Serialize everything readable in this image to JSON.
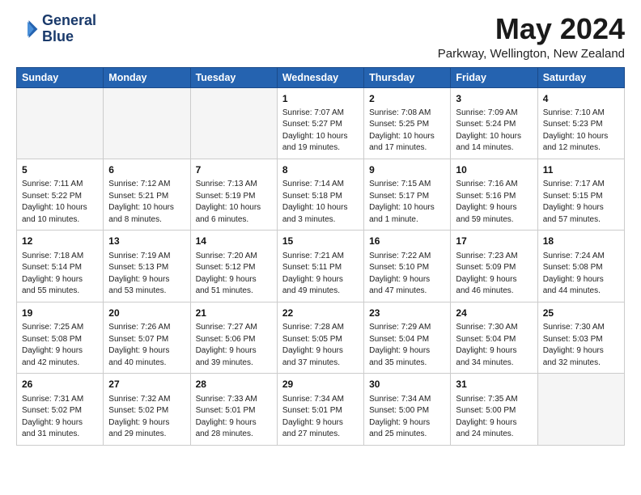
{
  "logo": {
    "line1": "General",
    "line2": "Blue"
  },
  "title": "May 2024",
  "location": "Parkway, Wellington, New Zealand",
  "days_of_week": [
    "Sunday",
    "Monday",
    "Tuesday",
    "Wednesday",
    "Thursday",
    "Friday",
    "Saturday"
  ],
  "weeks": [
    [
      {
        "day": "",
        "empty": true
      },
      {
        "day": "",
        "empty": true
      },
      {
        "day": "",
        "empty": true
      },
      {
        "day": "1",
        "sunrise": "7:07 AM",
        "sunset": "5:27 PM",
        "daylight": "10 hours and 19 minutes."
      },
      {
        "day": "2",
        "sunrise": "7:08 AM",
        "sunset": "5:25 PM",
        "daylight": "10 hours and 17 minutes."
      },
      {
        "day": "3",
        "sunrise": "7:09 AM",
        "sunset": "5:24 PM",
        "daylight": "10 hours and 14 minutes."
      },
      {
        "day": "4",
        "sunrise": "7:10 AM",
        "sunset": "5:23 PM",
        "daylight": "10 hours and 12 minutes."
      }
    ],
    [
      {
        "day": "5",
        "sunrise": "7:11 AM",
        "sunset": "5:22 PM",
        "daylight": "10 hours and 10 minutes."
      },
      {
        "day": "6",
        "sunrise": "7:12 AM",
        "sunset": "5:21 PM",
        "daylight": "10 hours and 8 minutes."
      },
      {
        "day": "7",
        "sunrise": "7:13 AM",
        "sunset": "5:19 PM",
        "daylight": "10 hours and 6 minutes."
      },
      {
        "day": "8",
        "sunrise": "7:14 AM",
        "sunset": "5:18 PM",
        "daylight": "10 hours and 3 minutes."
      },
      {
        "day": "9",
        "sunrise": "7:15 AM",
        "sunset": "5:17 PM",
        "daylight": "10 hours and 1 minute."
      },
      {
        "day": "10",
        "sunrise": "7:16 AM",
        "sunset": "5:16 PM",
        "daylight": "9 hours and 59 minutes."
      },
      {
        "day": "11",
        "sunrise": "7:17 AM",
        "sunset": "5:15 PM",
        "daylight": "9 hours and 57 minutes."
      }
    ],
    [
      {
        "day": "12",
        "sunrise": "7:18 AM",
        "sunset": "5:14 PM",
        "daylight": "9 hours and 55 minutes."
      },
      {
        "day": "13",
        "sunrise": "7:19 AM",
        "sunset": "5:13 PM",
        "daylight": "9 hours and 53 minutes."
      },
      {
        "day": "14",
        "sunrise": "7:20 AM",
        "sunset": "5:12 PM",
        "daylight": "9 hours and 51 minutes."
      },
      {
        "day": "15",
        "sunrise": "7:21 AM",
        "sunset": "5:11 PM",
        "daylight": "9 hours and 49 minutes."
      },
      {
        "day": "16",
        "sunrise": "7:22 AM",
        "sunset": "5:10 PM",
        "daylight": "9 hours and 47 minutes."
      },
      {
        "day": "17",
        "sunrise": "7:23 AM",
        "sunset": "5:09 PM",
        "daylight": "9 hours and 46 minutes."
      },
      {
        "day": "18",
        "sunrise": "7:24 AM",
        "sunset": "5:08 PM",
        "daylight": "9 hours and 44 minutes."
      }
    ],
    [
      {
        "day": "19",
        "sunrise": "7:25 AM",
        "sunset": "5:08 PM",
        "daylight": "9 hours and 42 minutes."
      },
      {
        "day": "20",
        "sunrise": "7:26 AM",
        "sunset": "5:07 PM",
        "daylight": "9 hours and 40 minutes."
      },
      {
        "day": "21",
        "sunrise": "7:27 AM",
        "sunset": "5:06 PM",
        "daylight": "9 hours and 39 minutes."
      },
      {
        "day": "22",
        "sunrise": "7:28 AM",
        "sunset": "5:05 PM",
        "daylight": "9 hours and 37 minutes."
      },
      {
        "day": "23",
        "sunrise": "7:29 AM",
        "sunset": "5:04 PM",
        "daylight": "9 hours and 35 minutes."
      },
      {
        "day": "24",
        "sunrise": "7:30 AM",
        "sunset": "5:04 PM",
        "daylight": "9 hours and 34 minutes."
      },
      {
        "day": "25",
        "sunrise": "7:30 AM",
        "sunset": "5:03 PM",
        "daylight": "9 hours and 32 minutes."
      }
    ],
    [
      {
        "day": "26",
        "sunrise": "7:31 AM",
        "sunset": "5:02 PM",
        "daylight": "9 hours and 31 minutes."
      },
      {
        "day": "27",
        "sunrise": "7:32 AM",
        "sunset": "5:02 PM",
        "daylight": "9 hours and 29 minutes."
      },
      {
        "day": "28",
        "sunrise": "7:33 AM",
        "sunset": "5:01 PM",
        "daylight": "9 hours and 28 minutes."
      },
      {
        "day": "29",
        "sunrise": "7:34 AM",
        "sunset": "5:01 PM",
        "daylight": "9 hours and 27 minutes."
      },
      {
        "day": "30",
        "sunrise": "7:34 AM",
        "sunset": "5:00 PM",
        "daylight": "9 hours and 25 minutes."
      },
      {
        "day": "31",
        "sunrise": "7:35 AM",
        "sunset": "5:00 PM",
        "daylight": "9 hours and 24 minutes."
      },
      {
        "day": "",
        "empty": true
      }
    ]
  ]
}
